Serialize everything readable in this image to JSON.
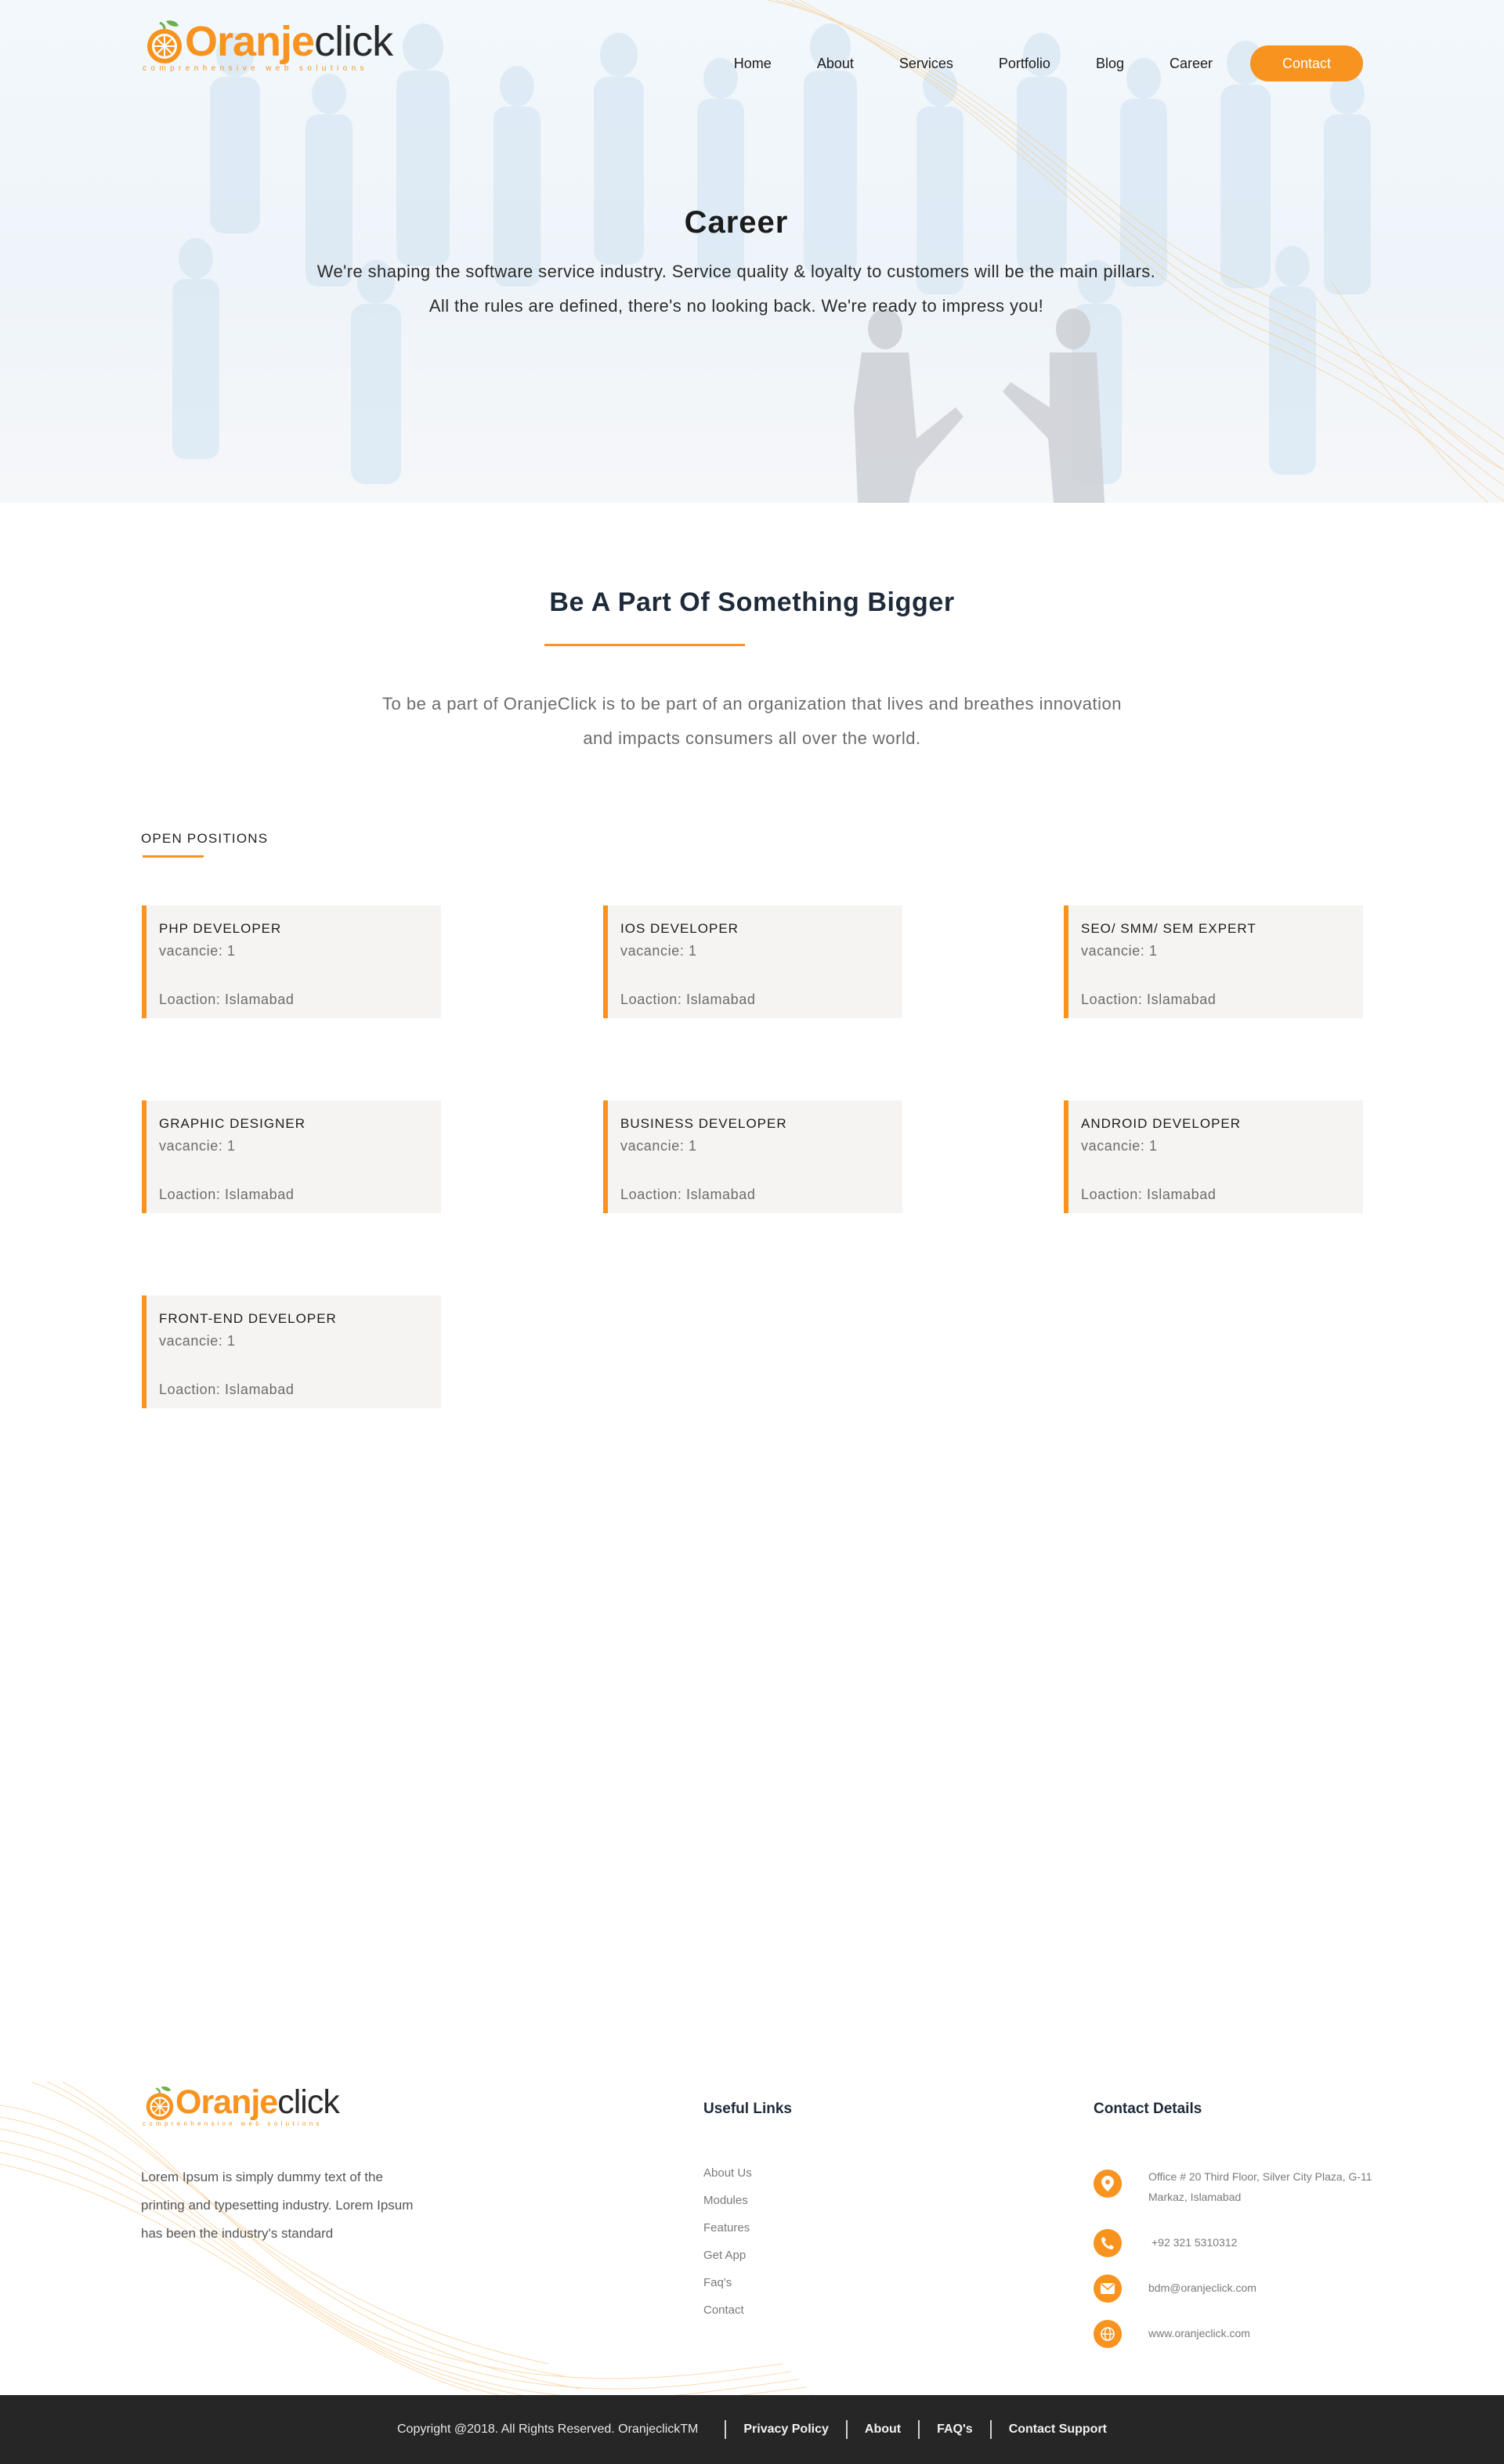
{
  "brand": {
    "name_orange": "Oranje",
    "name_dark": "click",
    "tagline": "comprenhensive web solutions"
  },
  "nav": {
    "items": [
      {
        "label": "Home"
      },
      {
        "label": "About"
      },
      {
        "label": "Services"
      },
      {
        "label": "Portfolio"
      },
      {
        "label": "Blog"
      },
      {
        "label": "Career"
      }
    ],
    "cta": "Contact"
  },
  "hero": {
    "title": "Career",
    "line1": "We're shaping the software service industry. Service quality & loyalty to customers will be the main pillars.",
    "line2": "All the rules are defined, there's no looking back. We're ready to impress you!"
  },
  "intro": {
    "title": "Be A Part Of Something Bigger",
    "line1": "To be a part of OranjeClick is to be part of an organization that lives and breathes innovation",
    "line2": "and impacts consumers all over the world."
  },
  "positions": {
    "heading": "OPEN POSITIONS",
    "items": [
      {
        "title": "PHP DEVELOPER",
        "vacancy": "vacancie: 1",
        "location": "Loaction: Islamabad"
      },
      {
        "title": "IOS DEVELOPER",
        "vacancy": "vacancie: 1",
        "location": "Loaction: Islamabad"
      },
      {
        "title": "SEO/ SMM/ SEM EXPERT",
        "vacancy": "vacancie: 1",
        "location": "Loaction: Islamabad"
      },
      {
        "title": "GRAPHIC DESIGNER",
        "vacancy": "vacancie: 1",
        "location": "Loaction: Islamabad"
      },
      {
        "title": "BUSINESS DEVELOPER",
        "vacancy": "vacancie: 1",
        "location": "Loaction: Islamabad"
      },
      {
        "title": "ANDROID DEVELOPER",
        "vacancy": "vacancie: 1",
        "location": "Loaction: Islamabad"
      },
      {
        "title": "FRONT-END DEVELOPER",
        "vacancy": "vacancie: 1",
        "location": "Loaction: Islamabad"
      }
    ]
  },
  "footer": {
    "about_text": "Lorem Ipsum is simply dummy text of the printing and typesetting industry. Lorem Ipsum has been the industry's standard",
    "useful_links_title": "Useful Links",
    "links": [
      "About Us",
      "Modules",
      "Features",
      "Get App",
      "Faq's",
      "Contact"
    ],
    "contact_title": "Contact Details",
    "contacts": [
      {
        "icon": "location-pin-icon",
        "text": "Office # 20 Third Floor, Silver City Plaza, G-11 Markaz, Islamabad"
      },
      {
        "icon": "phone-icon",
        "text": "+92 321 5310312"
      },
      {
        "icon": "mail-icon",
        "text": "bdm@oranjeclick.com"
      },
      {
        "icon": "globe-icon",
        "text": "www.oranjeclick.com"
      }
    ]
  },
  "bottom_bar": {
    "copyright": "Copyright @2018. All Rights Reserved. OranjeclickTM",
    "links": [
      "Privacy Policy",
      "About",
      "FAQ's",
      "Contact Support"
    ]
  },
  "colors": {
    "accent": "#f7931e",
    "card_bg": "#f6f4f3",
    "bottom_bar": "#262626"
  }
}
